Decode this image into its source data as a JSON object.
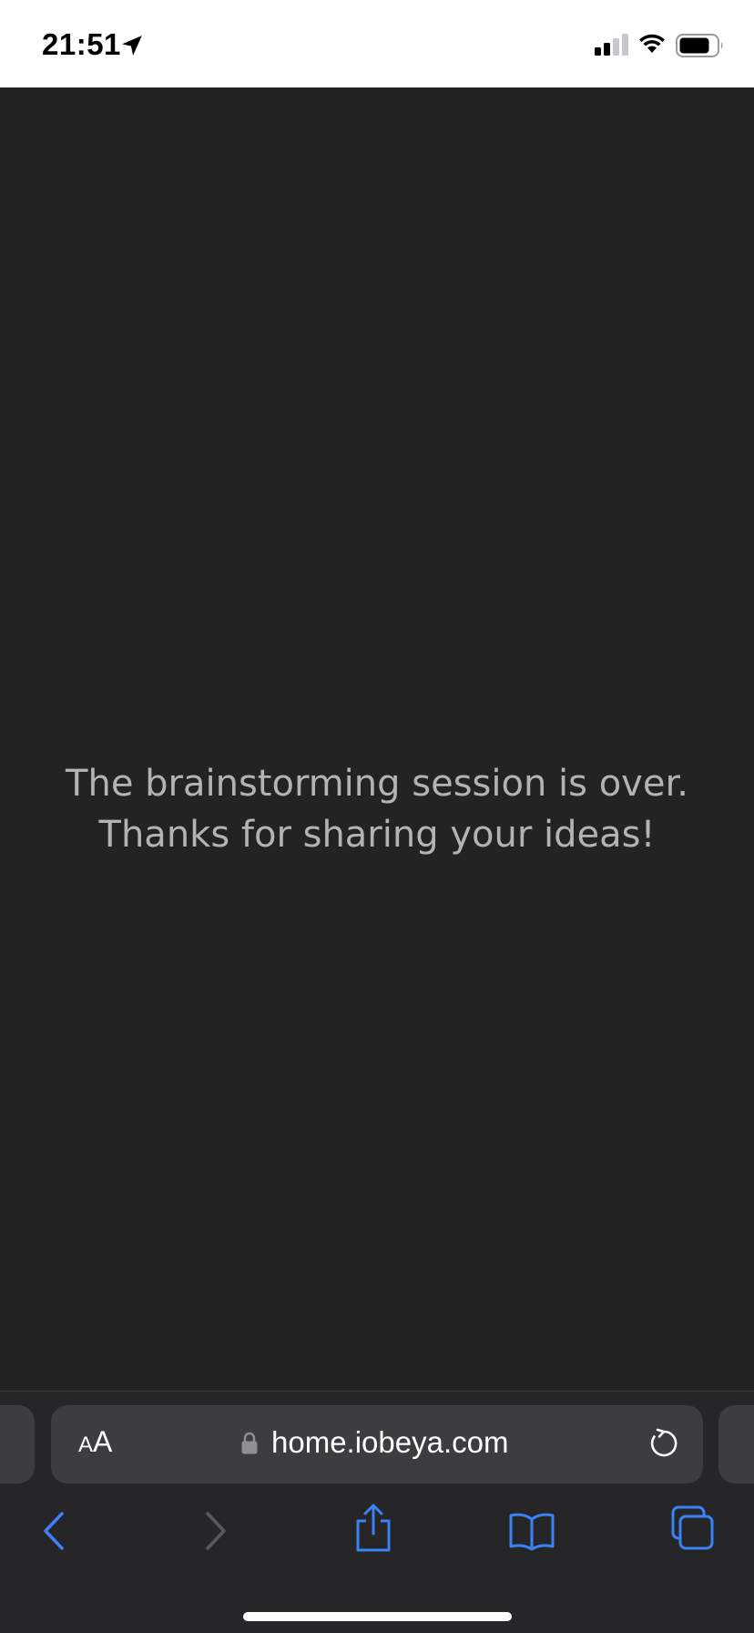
{
  "status_bar": {
    "time": "21:51",
    "icons": [
      "location-arrow-icon",
      "signal-icon",
      "wifi-icon",
      "battery-icon"
    ]
  },
  "page": {
    "message_line1": "The brainstorming session is over.",
    "message_line2": "Thanks for sharing your ideas!"
  },
  "address_bar": {
    "text_size_label_small": "A",
    "text_size_label_large": "A",
    "url": "home.iobeya.com"
  },
  "toolbar": {
    "buttons": [
      "back-icon",
      "forward-icon",
      "share-icon",
      "bookmarks-icon",
      "tabs-icon"
    ]
  },
  "colors": {
    "page_background": "#232324",
    "message_text": "#b3b3b3",
    "accent": "#3b82f6",
    "disabled": "#5a5a5e"
  }
}
